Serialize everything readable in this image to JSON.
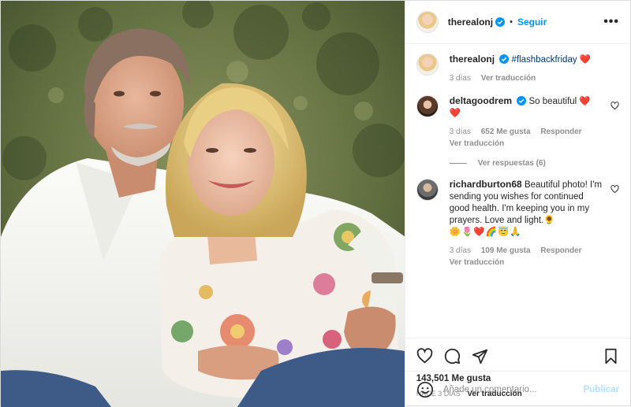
{
  "post": {
    "username": "therealonj",
    "follow_label": "Seguir",
    "dot": "•",
    "more_label": "•••"
  },
  "caption": {
    "username": "therealonj",
    "hashtag": "#flashbackfriday",
    "heart": "❤️",
    "time": "3 días",
    "translate": "Ver traducción"
  },
  "comments": [
    {
      "username": "deltagoodrem",
      "text": "So beautiful ❤️",
      "text2": "❤️",
      "time": "3 días",
      "likes": "652 Me gusta",
      "reply": "Responder",
      "translate": "Ver traducción",
      "replies": "Ver respuestas (6)"
    },
    {
      "username": "richardburton68",
      "text": "Beautiful photo! I'm sending you wishes for continued good health. I'm keeping you in my prayers. Love and light.🌻",
      "emojis": "🌼🌷❤️🌈😇🙏",
      "time": "3 días",
      "likes": "109 Me gusta",
      "reply": "Responder",
      "translate": "Ver traducción"
    }
  ],
  "stats": {
    "likes": "143,501 Me gusta",
    "ago": "HACE 3 DÍAS",
    "translate": "Ver traducción"
  },
  "composer": {
    "placeholder": "Añade un comentario...",
    "publish": "Publicar"
  },
  "icons": {
    "verified": "verified-badge-icon",
    "like": "heart-icon",
    "comment": "comment-icon",
    "share": "share-icon",
    "save": "bookmark-icon",
    "emoji": "emoji-icon"
  },
  "colors": {
    "accent": "#0095f6",
    "heart": "#ed4956",
    "muted": "#8e8e8e",
    "publish_disabled": "#b2dffc"
  }
}
